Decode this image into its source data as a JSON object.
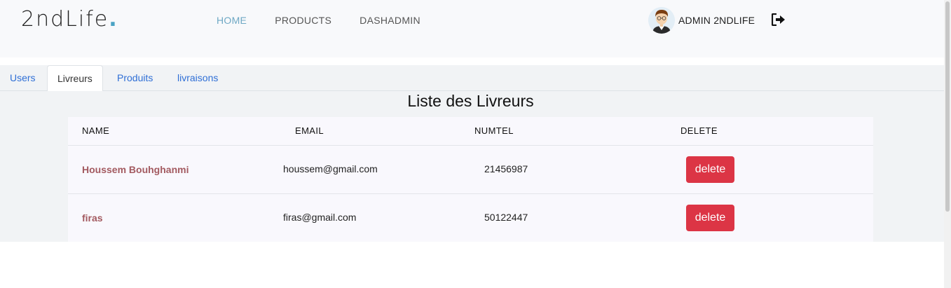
{
  "brand": {
    "name": "2ndLife",
    "dot": "."
  },
  "nav": {
    "items": [
      {
        "label": "HOME",
        "active": true
      },
      {
        "label": "PRODUCTS",
        "active": false
      },
      {
        "label": "DASHADMIN",
        "active": false
      }
    ]
  },
  "user": {
    "name": "ADMIN 2NDLIFE",
    "avatar_icon": "avatar-icon",
    "logout_icon": "logout-icon"
  },
  "tabs": [
    {
      "label": "Users",
      "active": false
    },
    {
      "label": "Livreurs",
      "active": true
    },
    {
      "label": "Produits",
      "active": false
    },
    {
      "label": "livraisons",
      "active": false
    }
  ],
  "page": {
    "title": "Liste des Livreurs"
  },
  "table": {
    "headers": [
      "NAME",
      "EMAIL",
      "NUMTEL",
      "DELETE"
    ],
    "rows": [
      {
        "name": "Houssem Bouhghanmi",
        "email": "houssem@gmail.com",
        "numtel": "21456987",
        "action": "delete"
      },
      {
        "name": "firas",
        "email": "firas@gmail.com",
        "numtel": "50122447",
        "action": "delete"
      }
    ]
  },
  "colors": {
    "accent": "#6ea8c4",
    "danger": "#dc3545",
    "link": "#2f6fd6",
    "name_text": "#a35a60"
  }
}
